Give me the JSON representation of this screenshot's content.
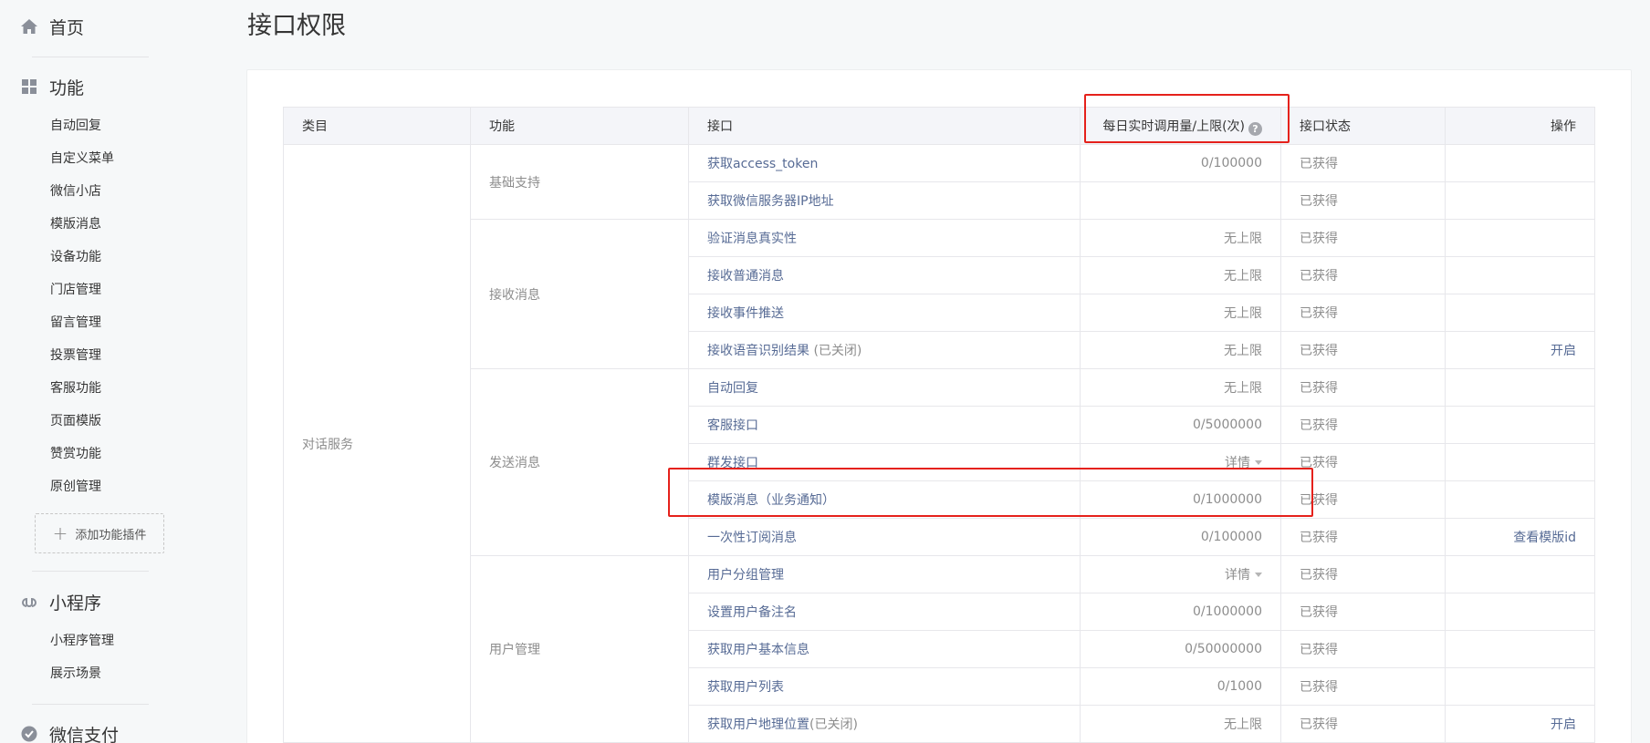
{
  "sidebar": {
    "home": {
      "label": "首页"
    },
    "features": {
      "label": "功能",
      "items": [
        "自动回复",
        "自定义菜单",
        "微信小店",
        "模版消息",
        "设备功能",
        "门店管理",
        "留言管理",
        "投票管理",
        "客服功能",
        "页面模版",
        "赞赏功能",
        "原创管理"
      ],
      "add_plugin": "添加功能插件"
    },
    "miniprogram": {
      "label": "小程序",
      "items": [
        "小程序管理",
        "展示场景"
      ]
    },
    "pay": {
      "label": "微信支付"
    }
  },
  "page": {
    "title": "接口权限"
  },
  "table": {
    "headers": {
      "category": "类目",
      "function": "功能",
      "api": "接口",
      "usage": "每日实时调用量/上限(次)",
      "status": "接口状态",
      "op": "操作"
    },
    "category": "对话服务",
    "groups": [
      {
        "name": "基础支持",
        "rows": [
          {
            "api": "获取access_token",
            "usage": "0/100000",
            "status": "已获得",
            "op": ""
          },
          {
            "api": "获取微信服务器IP地址",
            "usage": "",
            "status": "已获得",
            "op": ""
          }
        ]
      },
      {
        "name": "接收消息",
        "rows": [
          {
            "api": "验证消息真实性",
            "usage": "无上限",
            "status": "已获得",
            "op": ""
          },
          {
            "api": "接收普通消息",
            "usage": "无上限",
            "status": "已获得",
            "op": ""
          },
          {
            "api": "接收事件推送",
            "usage": "无上限",
            "status": "已获得",
            "op": ""
          },
          {
            "api": "接收语音识别结果",
            "api_suffix": " (已关闭)",
            "usage": "无上限",
            "status": "已获得",
            "op": "开启"
          }
        ]
      },
      {
        "name": "发送消息",
        "rows": [
          {
            "api": "自动回复",
            "usage": "无上限",
            "status": "已获得",
            "op": ""
          },
          {
            "api": "客服接口",
            "usage": "0/5000000",
            "status": "已获得",
            "op": ""
          },
          {
            "api": "群发接口",
            "usage": "详情",
            "status": "已获得",
            "op": ""
          },
          {
            "api": "模版消息（业务通知）",
            "usage": "0/1000000",
            "status": "已获得",
            "op": ""
          },
          {
            "api": "一次性订阅消息",
            "usage": "0/100000",
            "status": "已获得",
            "op": "查看模版id"
          }
        ]
      },
      {
        "name": "用户管理",
        "rows": [
          {
            "api": "用户分组管理",
            "usage": "详情",
            "status": "已获得",
            "op": ""
          },
          {
            "api": "设置用户备注名",
            "usage": "0/1000000",
            "status": "已获得",
            "op": ""
          },
          {
            "api": "获取用户基本信息",
            "usage": "0/50000000",
            "status": "已获得",
            "op": ""
          },
          {
            "api": "获取用户列表",
            "usage": "0/1000",
            "status": "已获得",
            "op": ""
          },
          {
            "api": "获取用户地理位置",
            "api_suffix": "(已关闭)",
            "usage": "无上限",
            "status": "已获得",
            "op": "开启"
          }
        ]
      }
    ]
  },
  "colors": {
    "link": "#576b95",
    "muted": "#8d8d8d",
    "highlight": "#e5211b"
  }
}
